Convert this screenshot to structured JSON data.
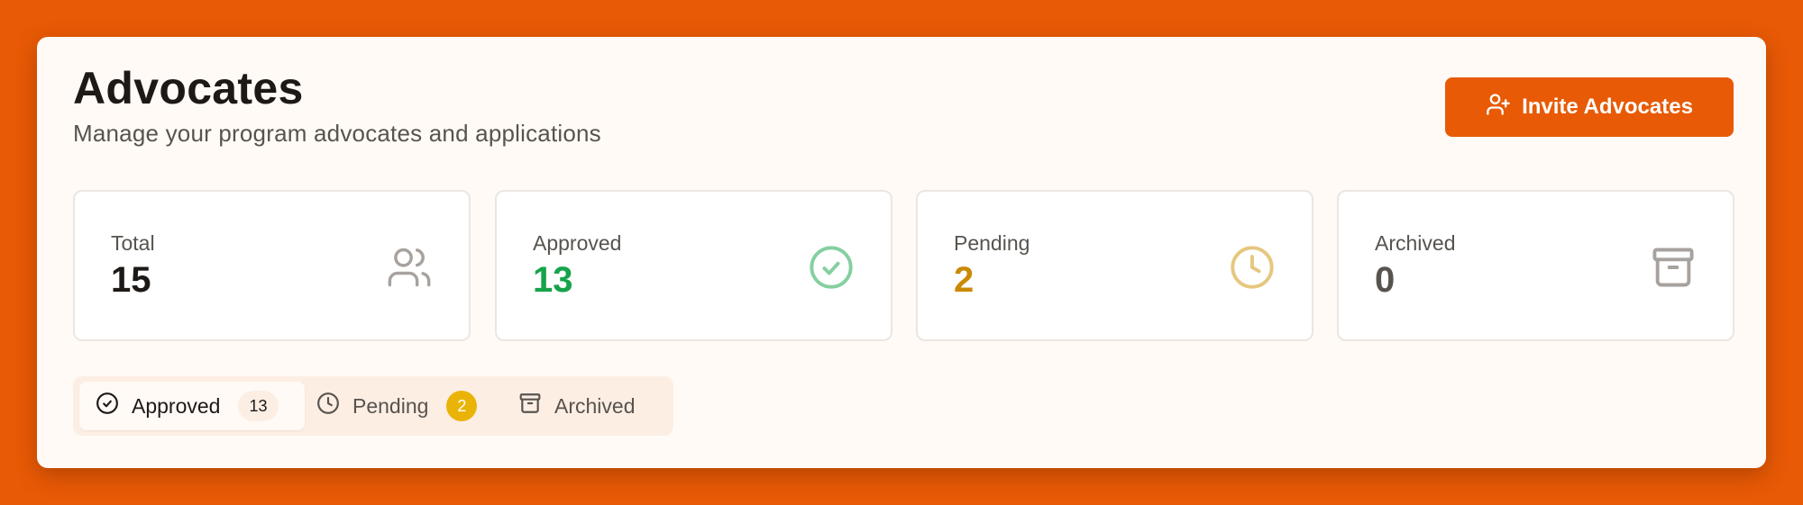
{
  "header": {
    "title": "Advocates",
    "subtitle": "Manage your program advocates and applications",
    "invite_label": "Invite Advocates"
  },
  "stats": [
    {
      "label": "Total",
      "value": "15",
      "color": "#1c1917",
      "icon": "users-icon"
    },
    {
      "label": "Approved",
      "value": "13",
      "color": "#16a34a",
      "icon": "check-circle-icon"
    },
    {
      "label": "Pending",
      "value": "2",
      "color": "#ca8a04",
      "icon": "clock-icon"
    },
    {
      "label": "Archived",
      "value": "0",
      "color": "#57534e",
      "icon": "archive-icon"
    }
  ],
  "tabs": [
    {
      "label": "Approved",
      "count": "13",
      "active": true,
      "icon": "check-circle-icon"
    },
    {
      "label": "Pending",
      "count": "2",
      "active": false,
      "icon": "clock-icon"
    },
    {
      "label": "Archived",
      "active": false,
      "icon": "archive-icon"
    }
  ],
  "colors": {
    "background": "#e85a05",
    "accent": "#e85a05",
    "approved": "#16a34a",
    "pending": "#ca8a04",
    "pending_badge": "#eab308"
  }
}
